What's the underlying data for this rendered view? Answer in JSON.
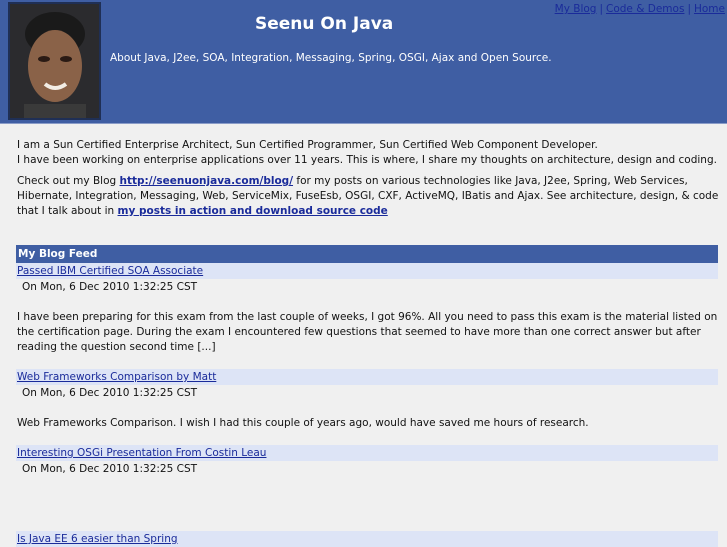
{
  "header": {
    "title": "Seenu On Java",
    "tagline": "About Java, J2ee, SOA, Integration, Messaging, Spring, OSGI, Ajax and Open Source.",
    "nav": [
      {
        "label": "My Blog"
      },
      {
        "label": "Code & Demos"
      },
      {
        "label": "Home"
      }
    ],
    "nav_sep": "|"
  },
  "intro": {
    "line1": "I am a Sun Certified Enterprise Architect, Sun Certified Programmer, Sun Certified Web Component Developer.",
    "line2": "I have been working on enterprise applications over 11 years. This is where, I share my thoughts on architecture, design and coding.",
    "p2_a": "Check out my Blog ",
    "blog_link": "http://seenuonjava.com/blog/",
    "p2_b": " for my posts on various technologies like Java, J2ee, Spring, Web Services, Hibernate, Integration, Messaging, Web, ServiceMix, FuseEsb, OSGI, CXF, ActiveMQ, IBatis and Ajax. See architecture, design, & code that I talk about in ",
    "posts_link": "my posts in action and download source code"
  },
  "feed": {
    "heading": "My Blog Feed",
    "items": [
      {
        "title": "Passed IBM Certified SOA Associate",
        "date": "On Mon, 6 Dec 2010 1:32:25 CST",
        "body": "I have been preparing for this exam from the last couple of weeks, I got 96%. All you need to pass this exam is the material listed on the certification page. During the exam I encountered few questions that seemed to have more than one correct answer but after reading the question second time [...]"
      },
      {
        "title": "Web Frameworks Comparison by Matt",
        "date": "On Mon, 6 Dec 2010 1:32:25 CST",
        "body": "Web Frameworks Comparison. I wish I had this couple of years ago, would have saved me hours of research."
      },
      {
        "title": "Interesting OSGi Presentation From Costin Leau",
        "date": "On Mon, 6 Dec 2010 1:32:25 CST",
        "body": ""
      },
      {
        "title": "Is Java EE 6 easier than Spring",
        "date": "",
        "body": ""
      }
    ]
  },
  "colors": {
    "header_bg": "#3f5ea3",
    "link": "#1a2b9a",
    "item_title_bg": "#dde4f6",
    "page_bg": "#f0f0f0"
  }
}
